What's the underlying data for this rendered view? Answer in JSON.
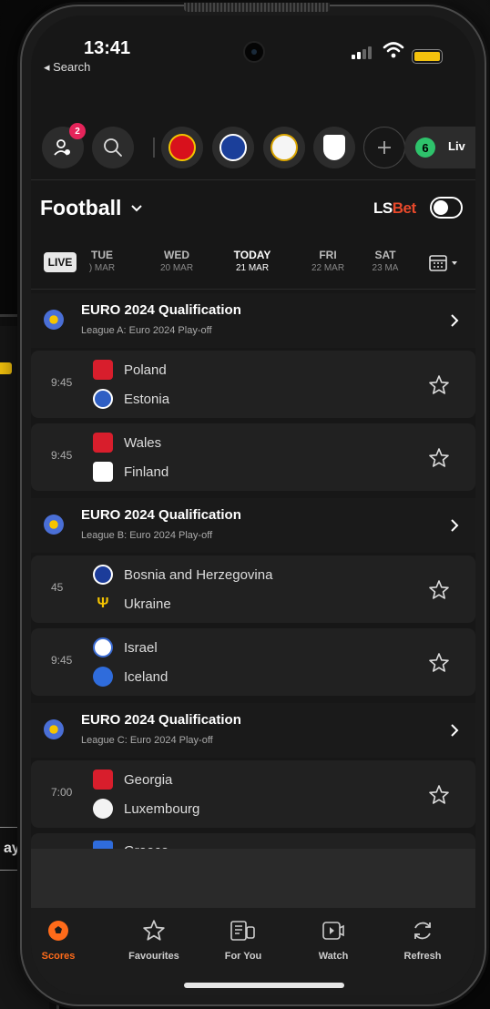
{
  "status": {
    "time": "13:41",
    "back_label": "◂ Search"
  },
  "shortcuts": {
    "notification_count": "2",
    "live_count": "6",
    "live_label": "Liv"
  },
  "header": {
    "sport": "Football",
    "brand_ls": "LS",
    "brand_bet": "Bet"
  },
  "dates": {
    "live_label": "LIVE",
    "days": [
      {
        "d": "TUE",
        "m": ") MAR"
      },
      {
        "d": "WED",
        "m": "20 MAR"
      },
      {
        "d": "TODAY",
        "m": "21 MAR"
      },
      {
        "d": "FRI",
        "m": "22 MAR"
      },
      {
        "d": "SAT",
        "m": "23 MA"
      }
    ]
  },
  "competitions": [
    {
      "title": "EURO 2024 Qualification",
      "sub": "League A: Euro 2024 Play-off"
    },
    {
      "title": "EURO 2024 Qualification",
      "sub": "League B: Euro 2024 Play-off"
    },
    {
      "title": "EURO 2024 Qualification",
      "sub": "League C: Euro 2024 Play-off"
    }
  ],
  "matches": [
    {
      "time": "9:45",
      "home": "Poland",
      "away": "Estonia"
    },
    {
      "time": "9:45",
      "home": "Wales",
      "away": "Finland"
    },
    {
      "time": "45",
      "home": "Bosnia and Herzegovina",
      "away": "Ukraine"
    },
    {
      "time": "9:45",
      "home": "Israel",
      "away": "Iceland"
    },
    {
      "time": "7:00",
      "home": "Georgia",
      "away": "Luxembourg"
    },
    {
      "time": "",
      "home": "Greece",
      "away": ""
    }
  ],
  "nav": [
    {
      "label": "Scores"
    },
    {
      "label": "Favourites"
    },
    {
      "label": "For You"
    },
    {
      "label": "Watch"
    },
    {
      "label": "Refresh"
    }
  ],
  "bg_phone": {
    "button_label": "ay"
  },
  "colors": {
    "accent": "#ff6b1a",
    "live_green": "#2ec26b",
    "brand_red": "#e8492b",
    "badge": "#e5245a"
  }
}
